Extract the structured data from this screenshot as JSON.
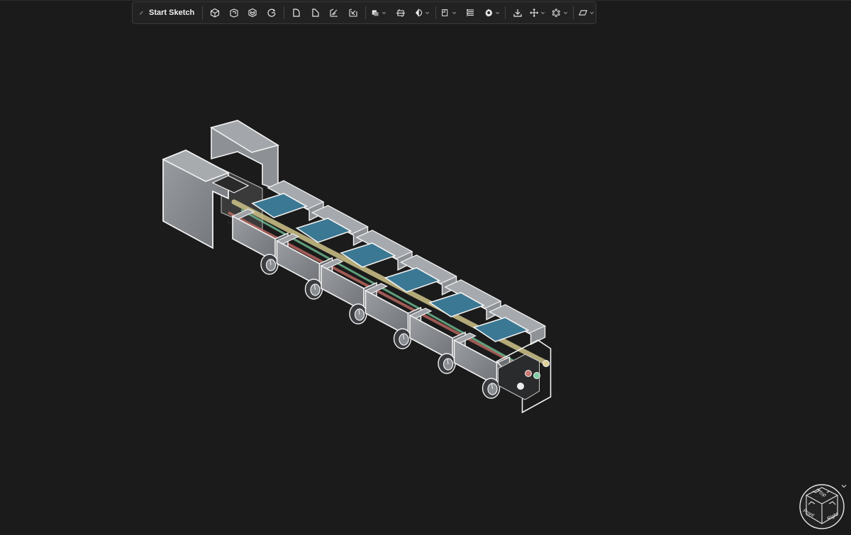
{
  "toolbar": {
    "start_sketch_label": "Start Sketch",
    "tools": [
      {
        "name": "box-tool",
        "icon": "cube-icon"
      },
      {
        "name": "extrude-tool",
        "icon": "extrude-icon"
      },
      {
        "name": "shell-tool",
        "icon": "shell-icon"
      },
      {
        "name": "revolve-tool",
        "icon": "revolve-icon"
      },
      {
        "name": "fillet-tool",
        "icon": "fillet-icon"
      },
      {
        "name": "chamfer-tool",
        "icon": "chamfer-icon"
      },
      {
        "name": "sweep-tool",
        "icon": "sweep-icon"
      },
      {
        "name": "loft-tool",
        "icon": "loft-icon"
      },
      {
        "name": "boolean-tool",
        "icon": "boolean-icon",
        "dropdown": true
      },
      {
        "name": "split-tool",
        "icon": "split-icon"
      },
      {
        "name": "mirror-tool",
        "icon": "mirror-icon",
        "dropdown": true
      },
      {
        "name": "plane-tool",
        "icon": "plane-icon",
        "dropdown": true
      },
      {
        "name": "align-tool",
        "icon": "align-icon"
      },
      {
        "name": "settings-tool",
        "icon": "gear-icon",
        "dropdown": true
      },
      {
        "name": "insert-tool",
        "icon": "insert-icon"
      },
      {
        "name": "move-tool",
        "icon": "move-icon",
        "dropdown": true
      },
      {
        "name": "pattern-tool",
        "icon": "pattern-icon",
        "dropdown": true
      },
      {
        "name": "view-tool",
        "icon": "parallelogram-icon",
        "dropdown": true
      }
    ]
  },
  "viewcube": {
    "top_label": "Top",
    "front_label": "Front",
    "right_label": "Right"
  },
  "colors": {
    "background": "#1b1b1b",
    "toolbar_bg": "#222222",
    "body_gray": "#8a8d91",
    "edge_white": "#f2f2f2",
    "panel_blue": "#3b7893",
    "rod_yellow": "#cfc48a",
    "rod_red": "#c06a63",
    "rod_green": "#6fbf95"
  }
}
